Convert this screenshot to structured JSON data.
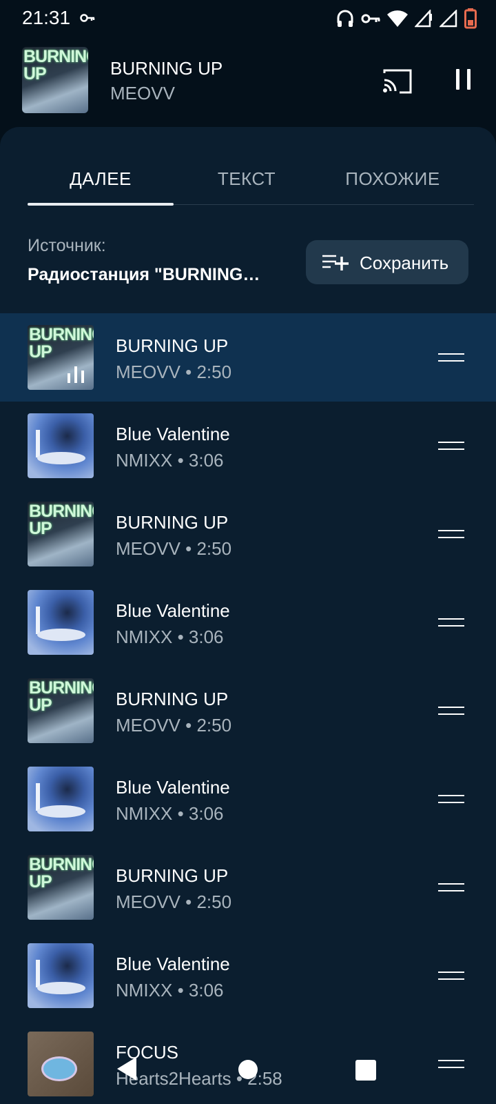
{
  "status_bar": {
    "time": "21:31"
  },
  "now_playing": {
    "title": "BURNING UP",
    "artist": "MEOVV",
    "art_text": "BURNING UP"
  },
  "tabs": [
    {
      "label": "ДАЛЕЕ",
      "active": true
    },
    {
      "label": "ТЕКСТ",
      "active": false
    },
    {
      "label": "ПОХОЖИЕ",
      "active": false
    }
  ],
  "source": {
    "label": "Источник:",
    "value": "Радиостанция \"BURNING…",
    "save_label": "Сохранить"
  },
  "queue": [
    {
      "title": "BURNING UP",
      "subtitle": "MEOVV • 2:50",
      "art": "burning",
      "art_text": "BURNING UP",
      "current": true
    },
    {
      "title": "Blue Valentine",
      "subtitle": "NMIXX • 3:06",
      "art": "blue"
    },
    {
      "title": "BURNING UP",
      "subtitle": "MEOVV • 2:50",
      "art": "burning",
      "art_text": "BURNING UP"
    },
    {
      "title": "Blue Valentine",
      "subtitle": "NMIXX • 3:06",
      "art": "blue"
    },
    {
      "title": "BURNING UP",
      "subtitle": "MEOVV • 2:50",
      "art": "burning",
      "art_text": "BURNING UP"
    },
    {
      "title": "Blue Valentine",
      "subtitle": "NMIXX • 3:06",
      "art": "blue"
    },
    {
      "title": "BURNING UP",
      "subtitle": "MEOVV • 2:50",
      "art": "burning",
      "art_text": "BURNING UP"
    },
    {
      "title": "Blue Valentine",
      "subtitle": "NMIXX • 3:06",
      "art": "blue"
    },
    {
      "title": "FOCUS",
      "subtitle": "Hearts2Hearts • 2:58",
      "art": "focus"
    }
  ],
  "colors": {
    "background": "#04101a",
    "sheet": "#0b1e2f",
    "current_row": "#0f3150",
    "secondary_text": "#a9b4bd",
    "save_button": "#22394c"
  }
}
